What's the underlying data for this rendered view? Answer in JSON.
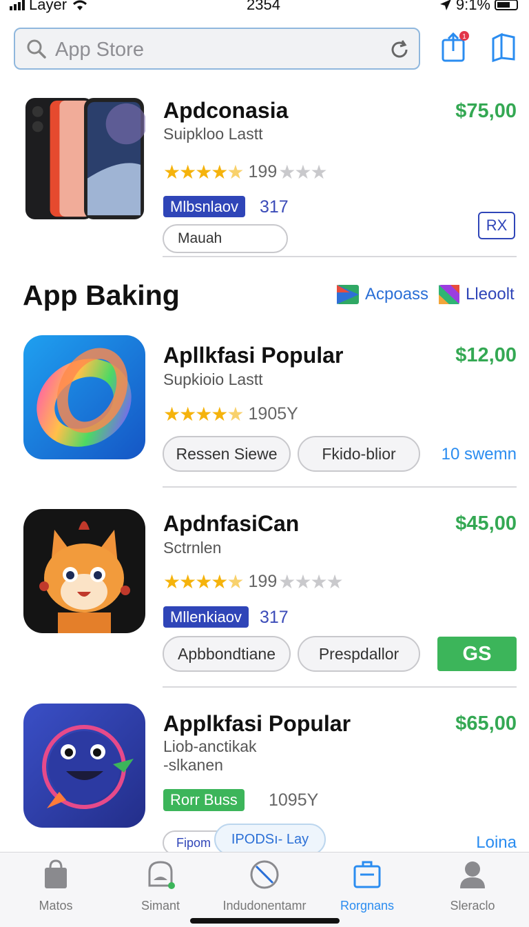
{
  "status_bar": {
    "carrier": "Layer",
    "time": "2354",
    "battery": "9:1%"
  },
  "search": {
    "placeholder": "App Store"
  },
  "header": {
    "notification_count": "1"
  },
  "featured": {
    "title": "Apdconasia",
    "subtitle": "Suipkloo Lastt",
    "price": "$75,00",
    "rating": 4.5,
    "rating_count": "199",
    "badge": "Mlbsnlaov",
    "badge_number": "317",
    "chip": "Mauah",
    "corner_button": "RX"
  },
  "section": {
    "title": "App Baking",
    "links": [
      {
        "label": "Acpoass",
        "icon": "play-store-icon"
      },
      {
        "label": "Lleoolt",
        "icon": "color-tile-icon"
      }
    ]
  },
  "apps": [
    {
      "title": "Apllkfasi Popular",
      "subtitle": "Supkioio Lastt",
      "price": "$12,00",
      "rating": 4.5,
      "rating_count": "1905Y",
      "pills": [
        "Ressen Siewe",
        "Fkido-blior"
      ],
      "link": "10 swemn"
    },
    {
      "title": "ApdnfasiCan",
      "subtitle": "Sctrnlen",
      "price": "$45,00",
      "rating": 4.5,
      "rating_count": "199",
      "badge": "Mllenkiaov",
      "badge_number": "317",
      "pills": [
        "Apbbondtiane",
        "Prespdallor"
      ],
      "action": "GS"
    },
    {
      "title": "Applkfasi Popular",
      "subtitle_line1": "Liob-anctikak",
      "subtitle_line2": "-slkanen",
      "price": "$65,00",
      "badge": "Rorr Buss",
      "rating_count": "1095Y",
      "chip1": "Fipom",
      "chip2": "IPODSı- Lay",
      "link": "Loina"
    }
  ],
  "tabs": [
    {
      "label": "Matos",
      "icon": "bag-icon"
    },
    {
      "label": "Simant",
      "icon": "bell-icon"
    },
    {
      "label": "Indudonentamr",
      "icon": "no-sign-icon"
    },
    {
      "label": "Rorgnans",
      "icon": "briefcase-icon",
      "active": true
    },
    {
      "label": "Sleraclo",
      "icon": "person-icon"
    }
  ],
  "colors": {
    "accent": "#2a8cf0",
    "price": "#34a853",
    "badge_blue": "#2f45b8",
    "badge_green": "#3cb55a"
  }
}
